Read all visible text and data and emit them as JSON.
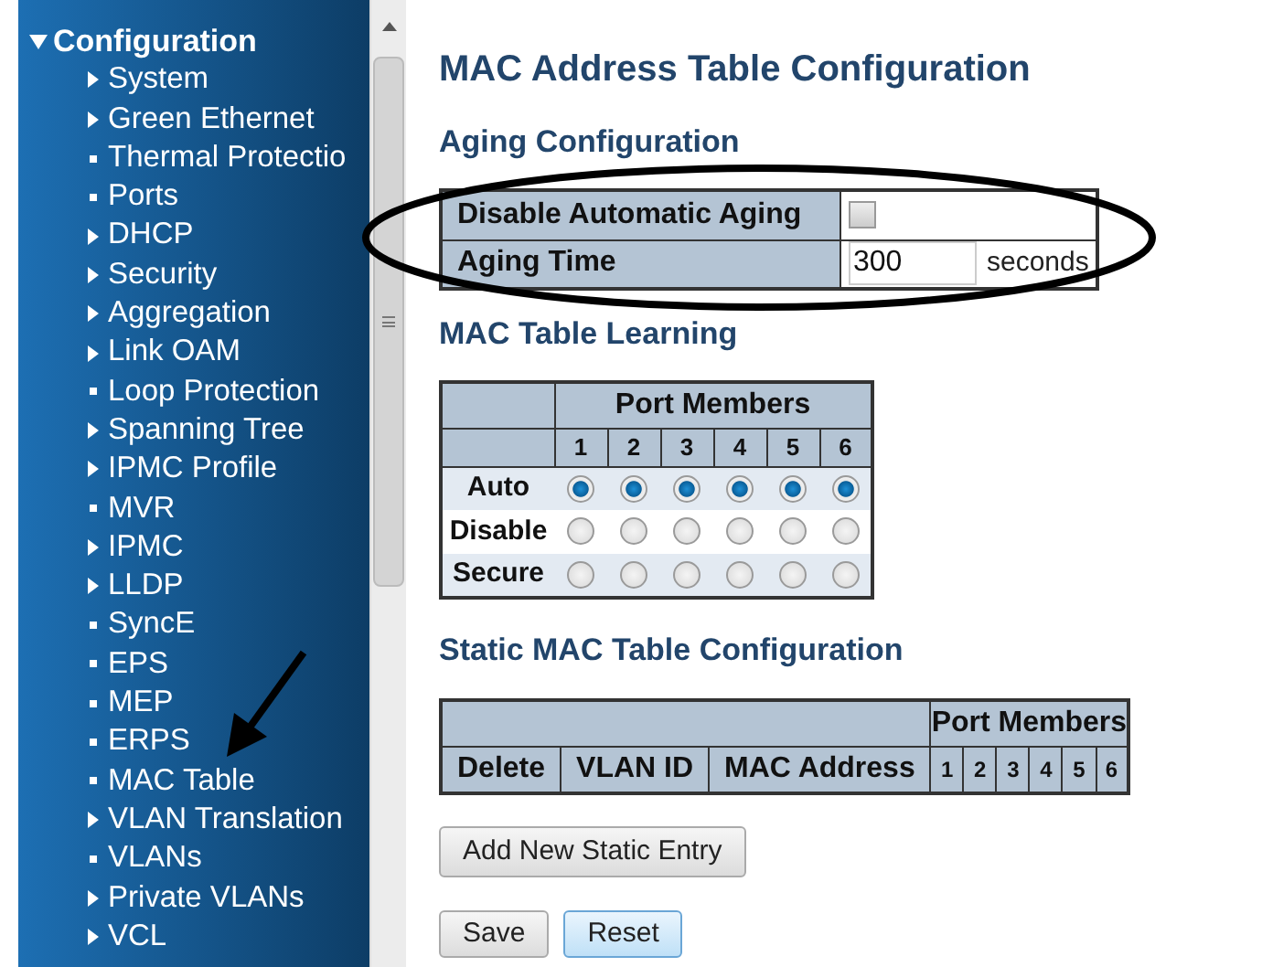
{
  "sidebar": {
    "header": {
      "label": "Configuration",
      "expanded": true
    },
    "items": [
      {
        "label": "System",
        "kind": "expandable"
      },
      {
        "label": "Green Ethernet",
        "kind": "expandable"
      },
      {
        "label": "Thermal Protectio",
        "kind": "leaf"
      },
      {
        "label": "Ports",
        "kind": "leaf"
      },
      {
        "label": "DHCP",
        "kind": "expandable"
      },
      {
        "label": "Security",
        "kind": "expandable"
      },
      {
        "label": "Aggregation",
        "kind": "expandable"
      },
      {
        "label": "Link OAM",
        "kind": "expandable"
      },
      {
        "label": "Loop Protection",
        "kind": "leaf"
      },
      {
        "label": "Spanning Tree",
        "kind": "expandable"
      },
      {
        "label": "IPMC Profile",
        "kind": "expandable"
      },
      {
        "label": "MVR",
        "kind": "leaf"
      },
      {
        "label": "IPMC",
        "kind": "expandable"
      },
      {
        "label": "LLDP",
        "kind": "expandable"
      },
      {
        "label": "SyncE",
        "kind": "leaf"
      },
      {
        "label": "EPS",
        "kind": "leaf"
      },
      {
        "label": "MEP",
        "kind": "leaf"
      },
      {
        "label": "ERPS",
        "kind": "leaf"
      },
      {
        "label": "MAC Table",
        "kind": "leaf"
      },
      {
        "label": "VLAN Translation",
        "kind": "expandable"
      },
      {
        "label": "VLANs",
        "kind": "leaf"
      },
      {
        "label": "Private VLANs",
        "kind": "expandable"
      },
      {
        "label": "VCL",
        "kind": "expandable"
      }
    ]
  },
  "page_title": "MAC Address Table Configuration",
  "aging": {
    "heading": "Aging Configuration",
    "disable_label": "Disable Automatic Aging",
    "disable_checked": false,
    "time_label": "Aging Time",
    "time_value": "300",
    "time_unit": "seconds"
  },
  "learning": {
    "heading": "MAC Table Learning",
    "group_header": "Port Members",
    "ports": [
      "1",
      "2",
      "3",
      "4",
      "5",
      "6"
    ],
    "rows": [
      {
        "label": "Auto",
        "selections": [
          true,
          true,
          true,
          true,
          true,
          true
        ]
      },
      {
        "label": "Disable",
        "selections": [
          false,
          false,
          false,
          false,
          false,
          false
        ]
      },
      {
        "label": "Secure",
        "selections": [
          false,
          false,
          false,
          false,
          false,
          false
        ]
      }
    ]
  },
  "static": {
    "heading": "Static MAC Table Configuration",
    "columns": [
      "Delete",
      "VLAN ID",
      "MAC Address"
    ],
    "group_header": "Port Members",
    "ports": [
      "1",
      "2",
      "3",
      "4",
      "5",
      "6"
    ]
  },
  "buttons": {
    "add": "Add New Static Entry",
    "save": "Save",
    "reset": "Reset"
  }
}
